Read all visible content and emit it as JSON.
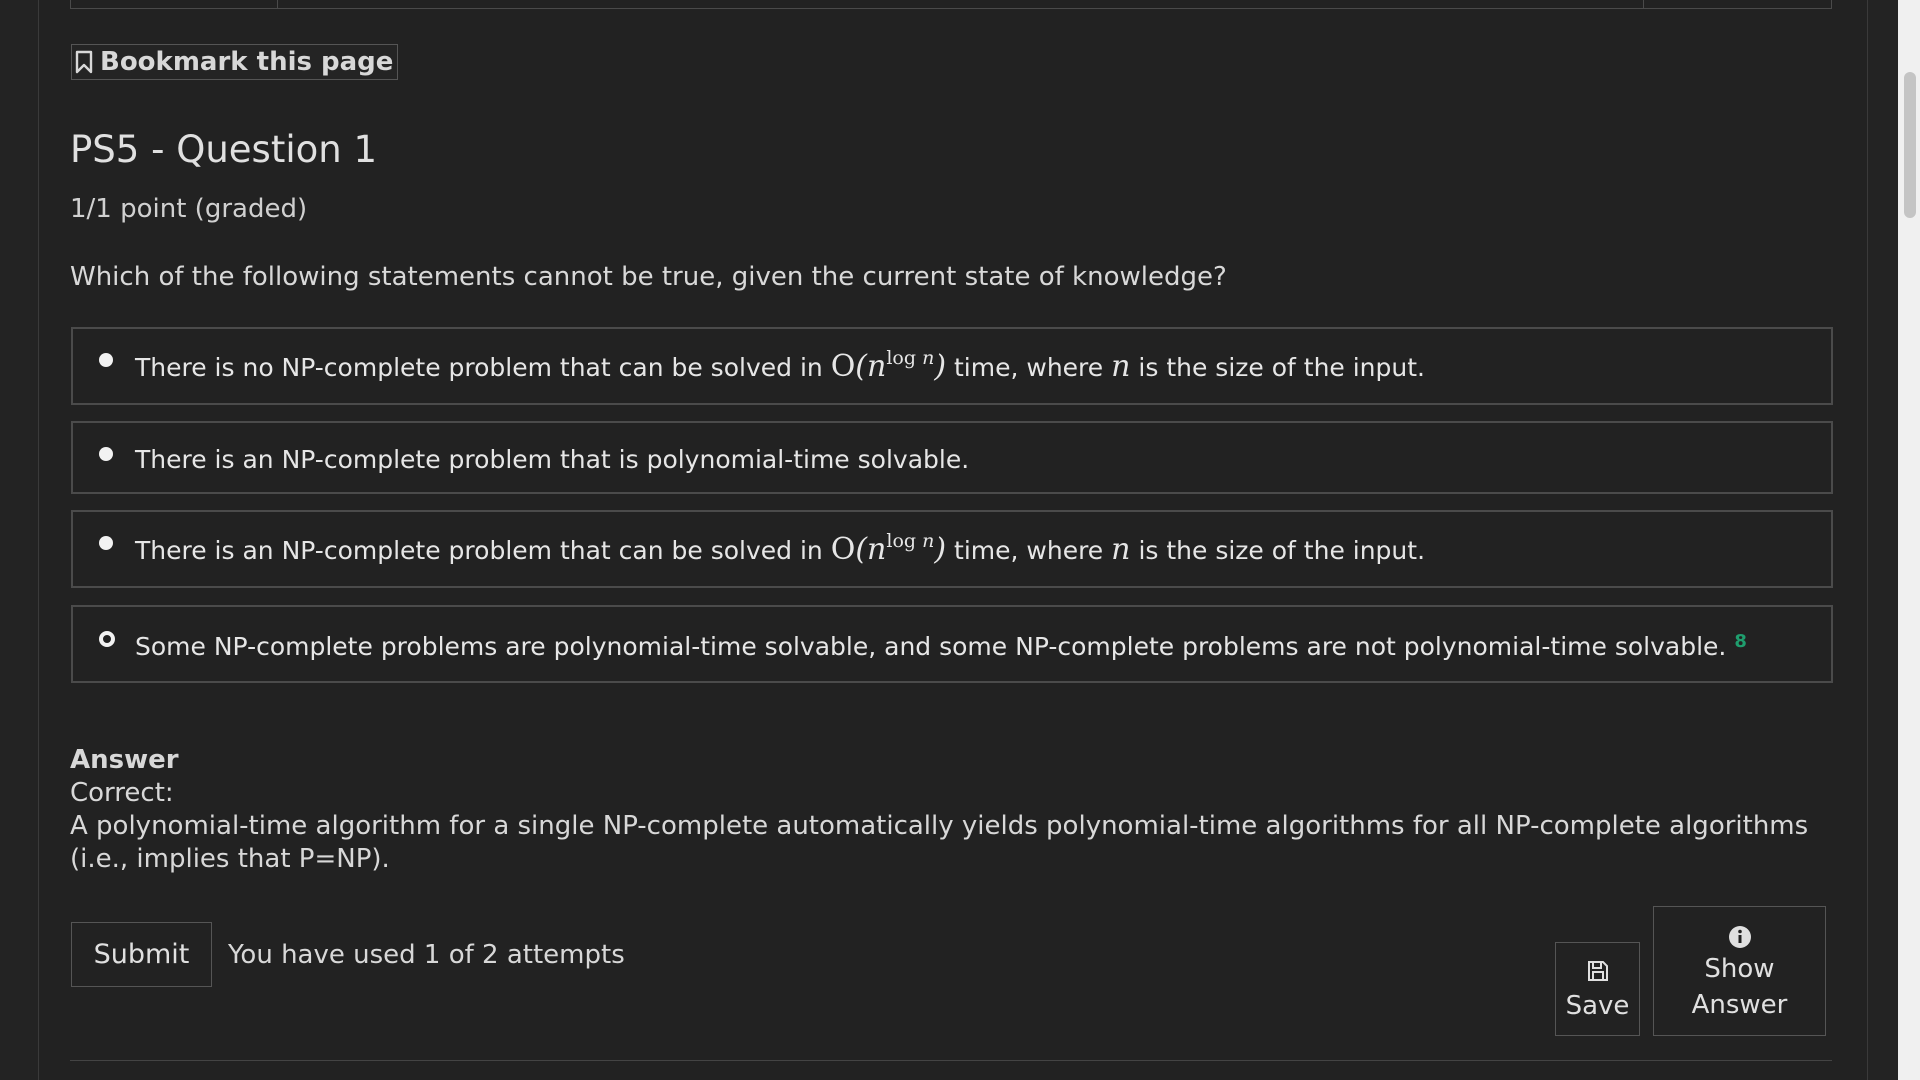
{
  "bookmark": {
    "label": "Bookmark this page"
  },
  "problem": {
    "title": "PS5 - Question 1",
    "points": "1/1 point (graded)",
    "question": "Which of the following statements cannot be true, given the current state of knowledge?"
  },
  "choices": [
    {
      "pre": "There is no NP-complete problem that can be solved in",
      "math_big": "O",
      "math_base": "n",
      "math_sup_fn": "log",
      "math_sup_var": "n",
      "mid": "time, where",
      "var": "n",
      "post": "is the size of the input.",
      "selected": false
    },
    {
      "text": "There is an NP-complete problem that is polynomial-time solvable.",
      "selected": false
    },
    {
      "pre": "There is an NP-complete problem that can be solved in",
      "math_big": "O",
      "math_base": "n",
      "math_sup_fn": "log",
      "math_sup_var": "n",
      "mid": "time, where",
      "var": "n",
      "post": "is the size of the input.",
      "selected": false
    },
    {
      "text": "Some NP-complete problems are polynomial-time solvable, and some NP-complete problems are not polynomial-time solvable.",
      "selected": true,
      "status_mark": "8"
    }
  ],
  "answer": {
    "heading": "Answer",
    "status": "Correct:",
    "explanation": "A polynomial-time algorithm for a single NP-complete automatically yields polynomial-time algorithms for all NP-complete algorithms (i.e., implies that P=NP)."
  },
  "actions": {
    "submit_label": "Submit",
    "attempts_text": "You have used 1 of 2 attempts",
    "save_label": "Save",
    "show_answer_label_1": "Show",
    "show_answer_label_2": "Answer"
  },
  "colors": {
    "background": "#222222",
    "correct_accent": "#1f9e6e",
    "scrollbar_track": "#f0f0f0",
    "scrollbar_thumb": "#c4c4c4"
  },
  "icons": {
    "bookmark": "bookmark-icon",
    "save": "floppy-disk-icon",
    "show_answer": "info-circle-icon"
  }
}
